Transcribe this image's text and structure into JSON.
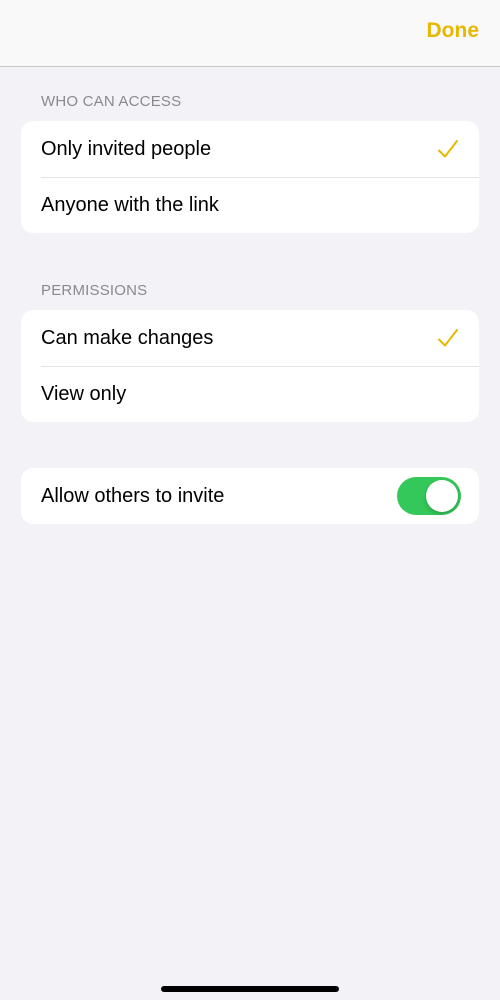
{
  "nav": {
    "done_label": "Done"
  },
  "who_can_access": {
    "header": "WHO CAN ACCESS",
    "options": [
      {
        "label": "Only invited people",
        "selected": true
      },
      {
        "label": "Anyone with the link",
        "selected": false
      }
    ]
  },
  "permissions": {
    "header": "PERMISSIONS",
    "options": [
      {
        "label": "Can make changes",
        "selected": true
      },
      {
        "label": "View only",
        "selected": false
      }
    ]
  },
  "invite": {
    "label": "Allow others to invite",
    "enabled": true
  },
  "icons": {
    "check": "checkmark-icon"
  },
  "colors": {
    "accent": "#e6b800",
    "toggle_on": "#34c759",
    "background": "#f2f2f7"
  }
}
